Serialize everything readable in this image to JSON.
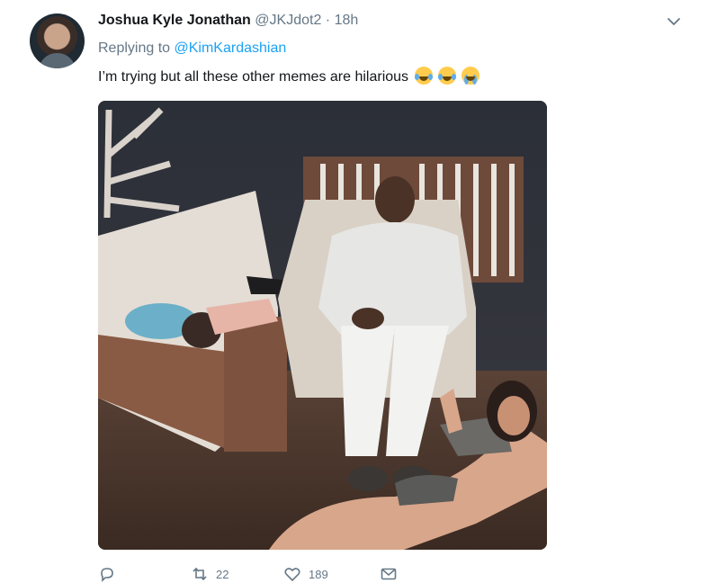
{
  "tweet": {
    "author_name": "Joshua Kyle Jonathan",
    "author_handle": "@JKJdot2",
    "separator": "·",
    "time": "18h",
    "replying_prefix": "Replying to",
    "replying_to": "@KimKardashian",
    "text": "I’m trying but all these other memes are hilarious",
    "emojis": [
      "face-with-tears-of-joy",
      "face-with-tears-of-joy",
      "loudly-crying-face"
    ]
  },
  "actions": {
    "reply_icon": "reply-icon",
    "retweet_icon": "retweet-icon",
    "retweet_count": "22",
    "like_icon": "heart-icon",
    "like_count": "189",
    "dm_icon": "message-icon"
  },
  "colors": {
    "text": "#14171a",
    "secondary": "#657786",
    "link": "#1da1f2"
  }
}
